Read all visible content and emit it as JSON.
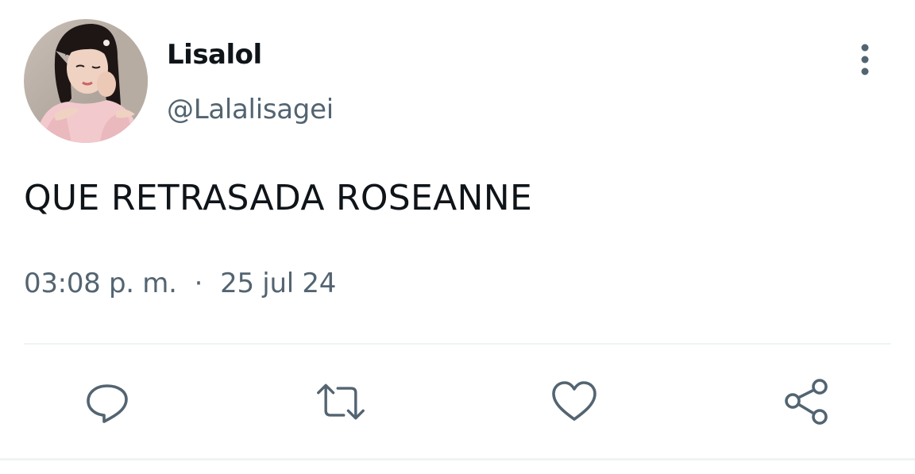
{
  "tweet": {
    "display_name": "Lisalol",
    "handle": "@Lalalisagei",
    "text": "QUE RETRASADA ROSEANNE",
    "time": "03:08 p. m.",
    "separator": "·",
    "date": "25 jul 24"
  },
  "icons": {
    "more": "more-vertical-icon",
    "reply": "reply-icon",
    "retweet": "retweet-icon",
    "like": "heart-icon",
    "share": "share-icon"
  },
  "colors": {
    "text_primary": "#0f1419",
    "text_secondary": "#536471",
    "divider": "#eff3f4"
  }
}
